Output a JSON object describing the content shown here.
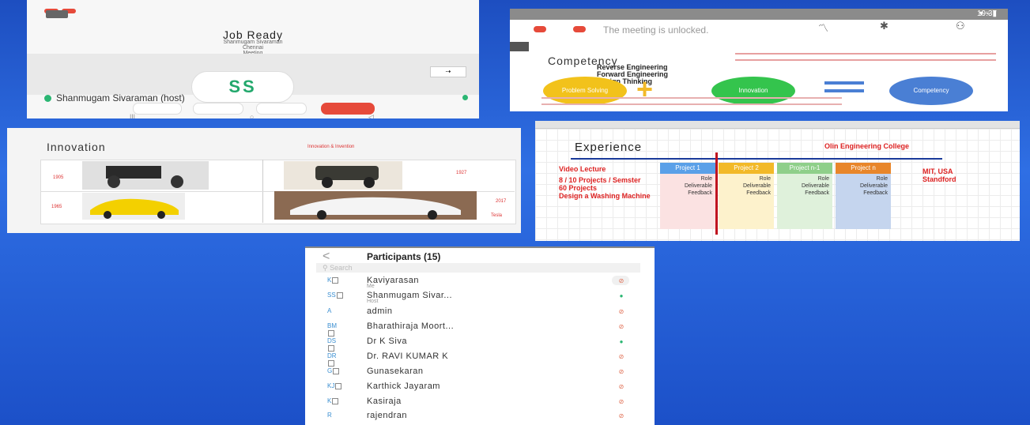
{
  "meeting": {
    "app_title": "Job Ready",
    "subtitle_line1": "Shanmugam Sivaraman",
    "subtitle_line2": "Chennai",
    "subtitle_line3": "Meeting",
    "avatar_initials": "SS",
    "host_label": "Shanmugam Sivaraman (host)"
  },
  "competency_slide": {
    "status_time": "19:37",
    "meeting_status": "The meeting is unlocked.",
    "heading": "Competency",
    "items": [
      "Reverse Engineering",
      "Forward Engineering",
      "Design Thinking"
    ],
    "circles": [
      {
        "label": "Problem Solving",
        "color": "#f2c21b"
      },
      {
        "label": "Innovation",
        "color": "#34c44d"
      },
      {
        "label": "Competency",
        "color": "#4a7fd4"
      }
    ]
  },
  "innovation_slide": {
    "heading": "Innovation",
    "header_right": "Innovation & Invention",
    "year_labels": [
      "1905",
      "1927",
      "1965",
      "2017"
    ],
    "footer_right": "Tesla"
  },
  "experience_slide": {
    "heading": "Experience",
    "college": "Olin Engineering College",
    "left_lines": [
      "Video Lecture",
      "8 / 10 Projects / Semster",
      "60 Projects",
      "Design a Washing Machine"
    ],
    "right_lines": [
      "MIT, USA",
      "Standford"
    ],
    "projects": [
      {
        "name": "Project 1",
        "color": "#5aa0e8",
        "rows": [
          "Role",
          "Deliverable",
          "Feedback"
        ]
      },
      {
        "name": "Project 2",
        "color": "#f2b928",
        "rows": [
          "Role",
          "Deliverable",
          "Feedback"
        ]
      },
      {
        "name": "Project n-1",
        "color": "#8fcf8a",
        "rows": [
          "Role",
          "Deliverable",
          "Feedback"
        ]
      },
      {
        "name": "Project n",
        "color": "#e8862a",
        "rows": [
          "Role",
          "Deliverable",
          "Feedback"
        ]
      }
    ]
  },
  "participants": {
    "title": "Participants (15)",
    "search_placeholder": "Search",
    "list": [
      {
        "initials": "K",
        "name": "Kaviyarasan",
        "role": "Me",
        "mic": "muted"
      },
      {
        "initials": "SS",
        "name": "Shanmugam Sivar...",
        "role": "Host",
        "mic": "on"
      },
      {
        "initials": "A",
        "name": "admin",
        "role": "",
        "mic": "muted"
      },
      {
        "initials": "BM",
        "name": "Bharathiraja Moort...",
        "role": "",
        "mic": "muted"
      },
      {
        "initials": "DS",
        "name": "Dr K Siva",
        "role": "",
        "mic": "on"
      },
      {
        "initials": "DR",
        "name": "Dr. RAVI KUMAR K",
        "role": "",
        "mic": "muted"
      },
      {
        "initials": "G",
        "name": "Gunasekaran",
        "role": "",
        "mic": "muted"
      },
      {
        "initials": "KJ",
        "name": "Karthick Jayaram",
        "role": "",
        "mic": "muted"
      },
      {
        "initials": "K",
        "name": "Kasiraja",
        "role": "",
        "mic": "muted"
      },
      {
        "initials": "R",
        "name": "rajendran",
        "role": "",
        "mic": "muted"
      }
    ]
  }
}
